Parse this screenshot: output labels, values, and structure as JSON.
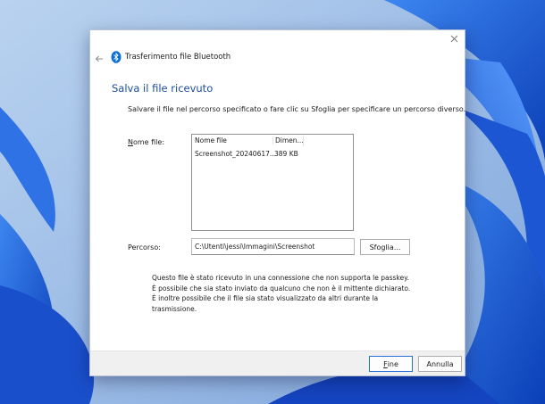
{
  "window": {
    "title": "Trasferimento file Bluetooth"
  },
  "page": {
    "heading": "Salva il file ricevuto",
    "instructions": "Salvare il file nel percorso specificato o fare clic su Sfoglia per specificare un percorso diverso."
  },
  "filename": {
    "label_first": "N",
    "label_rest": "ome file:"
  },
  "file_list": {
    "columns": [
      "Nome file",
      "Dimen..."
    ],
    "rows": [
      {
        "name": "Screenshot_20240617...",
        "size": "389 KB"
      }
    ]
  },
  "path": {
    "label": "Percorso:",
    "value": "C:\\Utenti\\jessi\\Immagini\\Screenshot",
    "browse_label": "Sfoglia..."
  },
  "info": {
    "text": "Questo file è stato ricevuto in una connessione che non supporta le passkey. È possibile che sia stato inviato da qualcuno che non è il mittente dichiarato. È inoltre possibile che il file sia stato visualizzato da altri durante la trasmissione."
  },
  "footer": {
    "finish_first": "F",
    "finish_rest": "ine",
    "cancel_label": "Annulla"
  },
  "colors": {
    "accent": "#1a4d9c",
    "default_button_border": "#2a6ed8",
    "wallpaper_blue": "#1f5fd6"
  },
  "icons": {
    "close": "close-icon",
    "back": "back-arrow-icon",
    "bluetooth": "bluetooth-icon"
  }
}
